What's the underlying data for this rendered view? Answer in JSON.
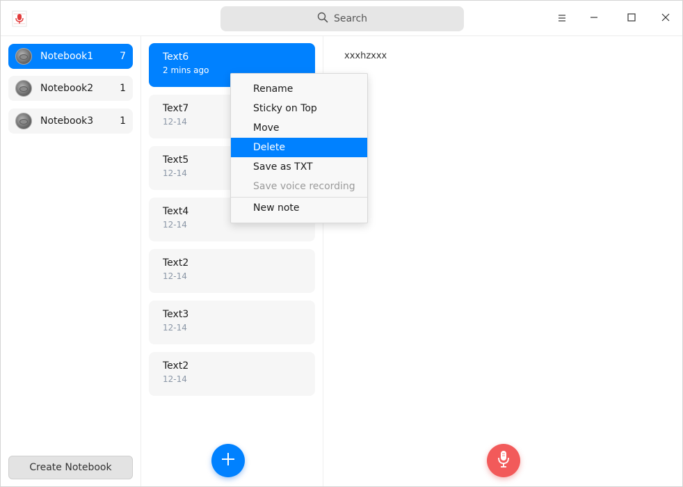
{
  "search": {
    "label": "Search"
  },
  "notebooks": [
    {
      "name": "Notebook1",
      "count": "7",
      "active": true
    },
    {
      "name": "Notebook2",
      "count": "1",
      "active": false
    },
    {
      "name": "Notebook3",
      "count": "1",
      "active": false
    }
  ],
  "create_notebook_label": "Create Notebook",
  "notes": [
    {
      "title": "Text6",
      "date": "2 mins ago",
      "active": true
    },
    {
      "title": "Text7",
      "date": "12-14",
      "active": false
    },
    {
      "title": "Text5",
      "date": "12-14",
      "active": false
    },
    {
      "title": "Text4",
      "date": "12-14",
      "active": false
    },
    {
      "title": "Text2",
      "date": "12-14",
      "active": false
    },
    {
      "title": "Text3",
      "date": "12-14",
      "active": false
    },
    {
      "title": "Text2",
      "date": "12-14",
      "active": false
    }
  ],
  "editor": {
    "content": "xxxhzxxx"
  },
  "context_menu": {
    "items": [
      {
        "label": "Rename",
        "state": "normal"
      },
      {
        "label": "Sticky on Top",
        "state": "normal"
      },
      {
        "label": "Move",
        "state": "normal"
      },
      {
        "label": "Delete",
        "state": "highlight"
      },
      {
        "label": "Save as TXT",
        "state": "normal"
      },
      {
        "label": "Save voice recording",
        "state": "disabled"
      },
      {
        "label": "New note",
        "state": "normal"
      }
    ]
  },
  "colors": {
    "accent": "#0081ff",
    "record": "#f25a5a"
  },
  "icons": {
    "app": "voice-notes-icon",
    "search": "search-icon",
    "menu": "hamburger-icon",
    "minimize": "minimize-icon",
    "maximize": "maximize-icon",
    "close": "close-icon",
    "add": "plus-icon",
    "record": "microphone-icon"
  }
}
